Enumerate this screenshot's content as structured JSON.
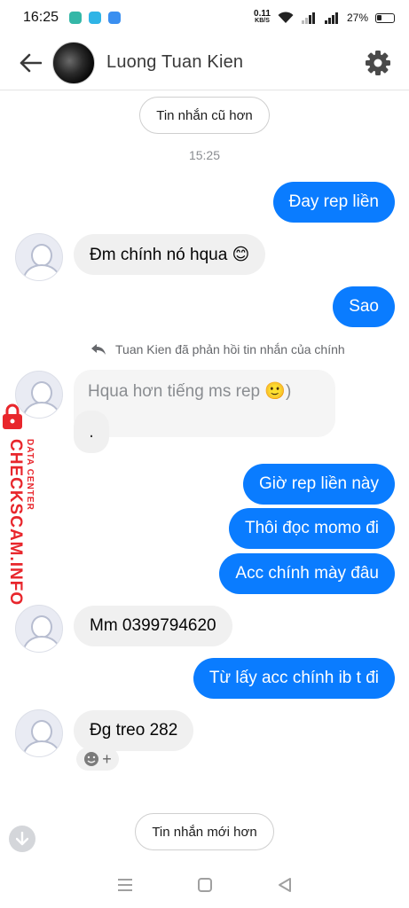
{
  "status_bar": {
    "time": "16:25",
    "net_speed_value": "0.11",
    "net_speed_unit": "KB/S",
    "battery": "27%"
  },
  "header": {
    "title": "Luong Tuan Kien"
  },
  "older_messages_button": "Tin nhắn cũ hơn",
  "timestamp": "15:25",
  "messages": [
    {
      "direction": "out",
      "text": "Đay rep liền"
    },
    {
      "direction": "in",
      "text": "Đm chính nó hqua 😊"
    },
    {
      "direction": "out",
      "text": "Sao"
    },
    {
      "direction": "in-reply",
      "reply_note": "Tuan Kien đã phản hồi tin nhắn của chính",
      "quoted": "Hqua hơn tiếng ms rep 🙂)",
      "text": "."
    },
    {
      "direction": "out",
      "text": "Giờ rep liền này"
    },
    {
      "direction": "out",
      "text": "Thôi đọc momo đi"
    },
    {
      "direction": "out",
      "text": "Acc chính mày đâu"
    },
    {
      "direction": "in",
      "text": "Mm 0399794620"
    },
    {
      "direction": "out",
      "text": "Từ lấy acc chính ib t đi"
    },
    {
      "direction": "in",
      "text": "Đg treo 282"
    }
  ],
  "newer_messages_button": "Tin nhắn mới hơn",
  "watermark": {
    "main": "CHECKSCAM.INFO",
    "sub": "DATA CENTER"
  },
  "colors": {
    "outgoing_bubble": "#0a7cff",
    "incoming_bubble": "#f0f0f0",
    "watermark": "#e8262c"
  }
}
